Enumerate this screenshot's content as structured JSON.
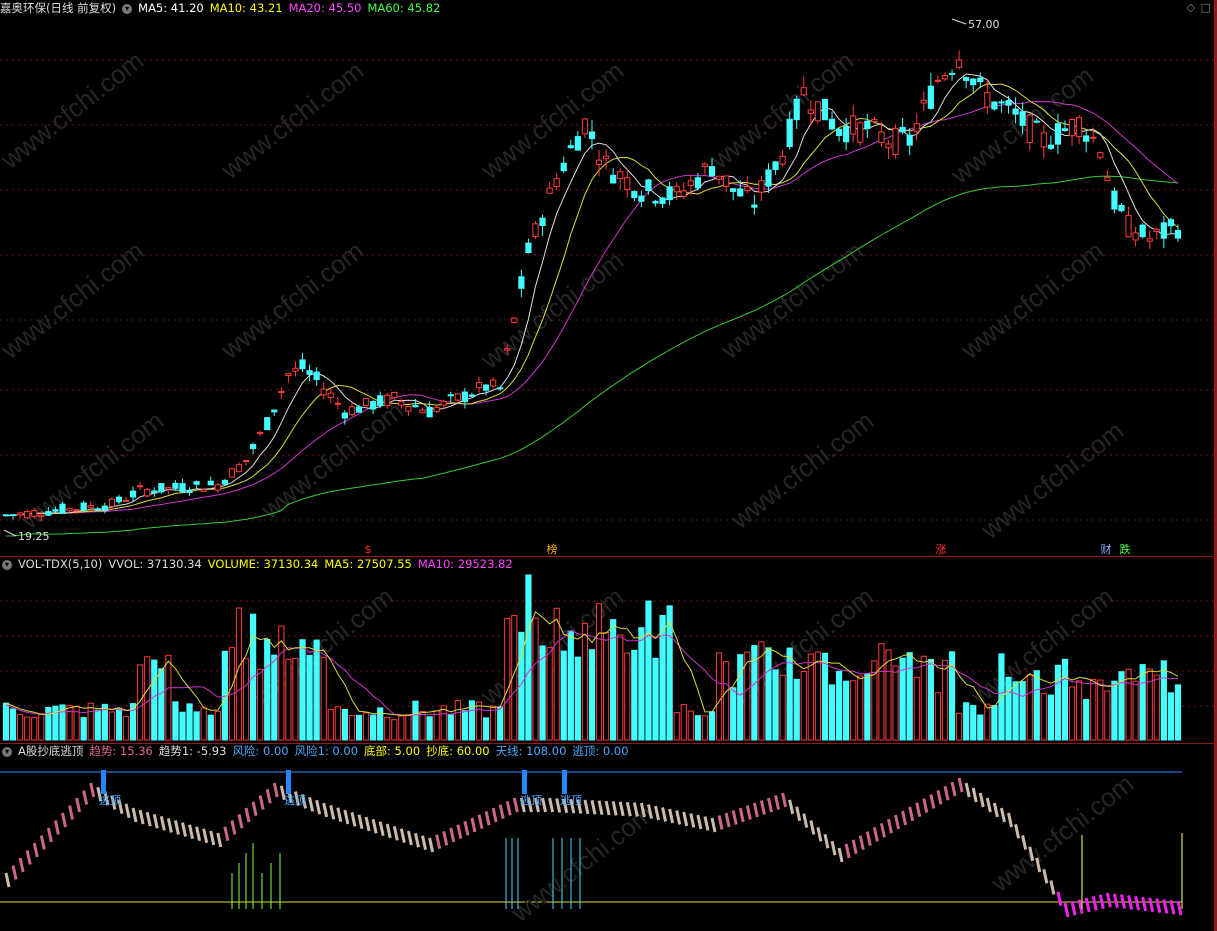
{
  "price_pane": {
    "title": "嘉奥环保(日线 前复权)",
    "ma_labels": [
      {
        "text": "MA5: 41.20",
        "color": "#ffffff"
      },
      {
        "text": "MA10: 43.21",
        "color": "#ffff00"
      },
      {
        "text": "MA20: 45.50",
        "color": "#ff44ff"
      },
      {
        "text": "MA60: 45.82",
        "color": "#44ff44"
      }
    ],
    "high_label": "57.00",
    "low_label": "19.25",
    "event_markers": [
      {
        "text": "$",
        "color": "#ff3333"
      },
      {
        "text": "榜",
        "color": "#ffaa00"
      },
      {
        "text": "涨",
        "color": "#ff3333"
      },
      {
        "text": "财",
        "color": "#88aaff"
      },
      {
        "text": "跌",
        "color": "#44ff44"
      }
    ],
    "watermark": "www.cfchi.com"
  },
  "volume_pane": {
    "title": "VOL-TDX(5,10)",
    "labels": [
      {
        "text": "VVOL: 37130.34",
        "color": "#dddddd"
      },
      {
        "text": "VOLUME: 37130.34",
        "color": "#ffff00"
      },
      {
        "text": "MA5: 27507.55",
        "color": "#ffff00"
      },
      {
        "text": "MA10: 29523.82",
        "color": "#ff44ff"
      }
    ]
  },
  "indicator_pane": {
    "title": "A股抄底逃顶",
    "labels": [
      {
        "text": "趋势: 15.36",
        "color": "#dd6688"
      },
      {
        "text": "趋势1: -5.93",
        "color": "#dddddd"
      },
      {
        "text": "风险: 0.00",
        "color": "#44aaff"
      },
      {
        "text": "风险1: 0.00",
        "color": "#44aaff"
      },
      {
        "text": "底部: 5.00",
        "color": "#ffff00"
      },
      {
        "text": "抄底: 60.00",
        "color": "#ffff00"
      },
      {
        "text": "天线: 108.00",
        "color": "#44aaff"
      },
      {
        "text": "逃顶: 0.00",
        "color": "#44aaff"
      }
    ],
    "escape_label": "逃顶"
  }
}
